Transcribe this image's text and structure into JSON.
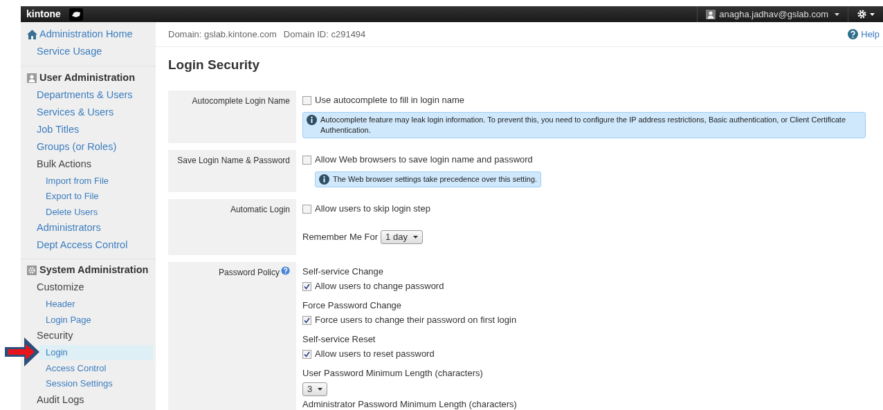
{
  "topbar": {
    "logo": "kintone",
    "user": "anagha.jadhav@gslab.com"
  },
  "sidebar": {
    "home": "Administration Home",
    "top_items": [
      {
        "label": "Service Usage",
        "selected": false
      }
    ],
    "sections": [
      {
        "title": "User Administration",
        "items": [
          {
            "label": "Departments & Users",
            "selected": false,
            "link": true
          },
          {
            "label": "Services & Users",
            "selected": false,
            "link": true
          },
          {
            "label": "Job Titles",
            "selected": false,
            "link": true
          },
          {
            "label": "Groups (or Roles)",
            "selected": false,
            "link": true
          },
          {
            "label": "Bulk Actions",
            "selected": false,
            "link": false,
            "children": [
              {
                "label": "Import from File",
                "selected": false,
                "link": true
              },
              {
                "label": "Export to File",
                "selected": false,
                "link": true
              },
              {
                "label": "Delete Users",
                "selected": false,
                "link": true
              }
            ]
          },
          {
            "label": "Administrators",
            "selected": false,
            "link": true
          },
          {
            "label": "Dept Access Control",
            "selected": false,
            "link": true
          }
        ]
      },
      {
        "title": "System Administration",
        "items": [
          {
            "label": "Customize",
            "selected": false,
            "link": false,
            "children": [
              {
                "label": "Header",
                "selected": false,
                "link": true
              },
              {
                "label": "Login Page",
                "selected": false,
                "link": true
              }
            ]
          },
          {
            "label": "Security",
            "selected": false,
            "link": false,
            "children": [
              {
                "label": "Login",
                "selected": true,
                "link": true
              },
              {
                "label": "Access Control",
                "selected": false,
                "link": true
              },
              {
                "label": "Session Settings",
                "selected": false,
                "link": true
              }
            ]
          },
          {
            "label": "Audit Logs",
            "selected": false,
            "link": false
          }
        ]
      }
    ]
  },
  "header": {
    "domain": "Domain: gslab.kintone.com",
    "domain_id": "Domain ID: c291494",
    "help": "Help"
  },
  "page_title": "Login Security",
  "settings": [
    {
      "label": "Autocomplete Login Name",
      "help": false,
      "items": [
        {
          "kind": "checkbox",
          "text": "Use autocomplete to fill in login name",
          "checked": false
        },
        {
          "kind": "info",
          "text": "Autocomplete feature may leak login information. To prevent this, you need to configure the IP address restrictions, Basic authentication, or Client Certificate Authentication.",
          "wide": true
        }
      ]
    },
    {
      "label": "Save Login Name & Password",
      "help": false,
      "items": [
        {
          "kind": "checkbox",
          "text": "Allow Web browsers to save login name and password",
          "checked": false
        },
        {
          "kind": "info",
          "text": "The Web browser settings take precedence over this setting.",
          "wide": false
        }
      ]
    },
    {
      "label": "Automatic Login",
      "help": false,
      "items": [
        {
          "kind": "checkbox",
          "text": "Allow users to skip login step",
          "checked": false
        },
        {
          "kind": "select",
          "label": "Remember Me For",
          "value": "1 day"
        }
      ]
    },
    {
      "label": "Password Policy",
      "help": true,
      "items": [
        {
          "kind": "subheading",
          "text": "Self-service Change"
        },
        {
          "kind": "checkbox",
          "text": "Allow users to change password",
          "checked": true
        },
        {
          "kind": "subheading",
          "text": "Force Password Change"
        },
        {
          "kind": "checkbox",
          "text": "Force users to change their password on first login",
          "checked": true
        },
        {
          "kind": "subheading",
          "text": "Self-service Reset"
        },
        {
          "kind": "checkbox",
          "text": "Allow users to reset password",
          "checked": true
        },
        {
          "kind": "subheading",
          "text": "User Password Minimum Length (characters)"
        },
        {
          "kind": "select",
          "value": "3"
        },
        {
          "kind": "subheading",
          "text": "Administrator Password Minimum Length (characters)"
        }
      ]
    }
  ]
}
